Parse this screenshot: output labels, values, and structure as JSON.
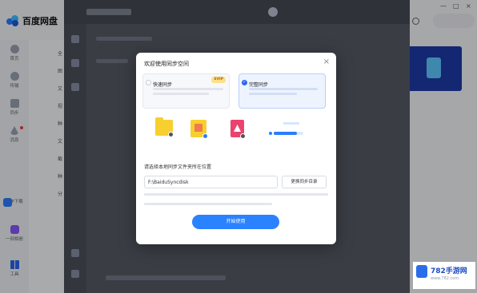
{
  "app": {
    "brand": "百度网盘",
    "window_controls": [
      "—",
      "□",
      "×"
    ]
  },
  "leftnav": {
    "items": [
      {
        "label": "首页",
        "icon": "home-icon"
      },
      {
        "label": "传输",
        "icon": "transfer-icon"
      },
      {
        "label": "同步",
        "icon": "sync-icon"
      },
      {
        "label": "消息",
        "icon": "message-icon"
      },
      {
        "label": "APP下载",
        "icon": "app-icon"
      },
      {
        "label": "一刻相册",
        "icon": "album-icon"
      },
      {
        "label": "工具",
        "icon": "tools-icon"
      }
    ]
  },
  "subnav": {
    "items": [
      "全",
      "图",
      "文",
      "视",
      "种",
      "文",
      "截",
      "种",
      "分"
    ]
  },
  "modal": {
    "title": "欢迎使用同步空间",
    "close": "×",
    "options": [
      {
        "title": "快速同步",
        "badge": "SVIP",
        "selected": false
      },
      {
        "title": "完整同步",
        "selected": true
      }
    ],
    "location_label": "请选择本地同步文件夹所在位置",
    "path_value": "F:\\BaiduSyncdisk",
    "change_button": "更换同步目录",
    "start_button": "开始使用",
    "progress_value": 0.78
  },
  "watermark": {
    "title": "782手游网",
    "subtitle": "www.782.com"
  }
}
